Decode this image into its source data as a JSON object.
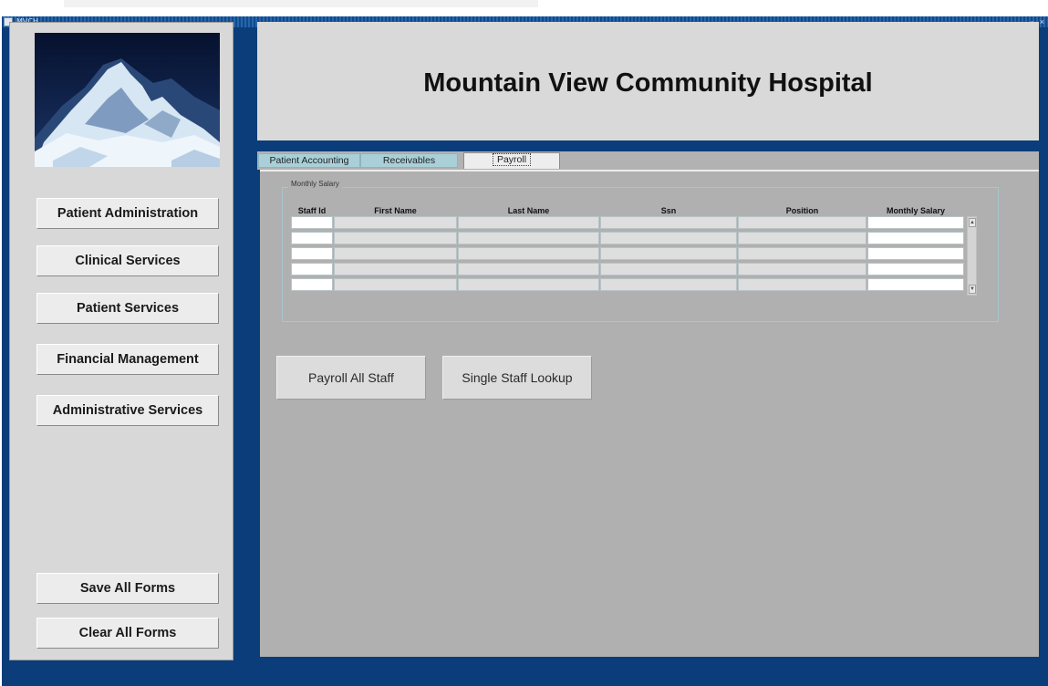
{
  "window": {
    "title": "MVCH",
    "controls": "_ ▫ ×"
  },
  "header": {
    "title": "Mountain View Community Hospital"
  },
  "sidebar": {
    "items": [
      {
        "label": "Patient Administration"
      },
      {
        "label": "Clinical Services"
      },
      {
        "label": "Patient Services"
      },
      {
        "label": "Financial Management"
      },
      {
        "label": "Administrative Services"
      }
    ],
    "save_label": "Save All Forms",
    "clear_label": "Clear All Forms"
  },
  "tabs": [
    {
      "label": "Patient Accounting"
    },
    {
      "label": "Receivables"
    },
    {
      "label": "Payroll"
    }
  ],
  "payroll": {
    "group_label": "Monthly Salary",
    "columns": [
      "Staff Id",
      "First Name",
      "Last Name",
      "Ssn",
      "Position",
      "Monthly Salary"
    ],
    "rows": [
      [
        "",
        "",
        "",
        "",
        "",
        ""
      ],
      [
        "",
        "",
        "",
        "",
        "",
        ""
      ],
      [
        "",
        "",
        "",
        "",
        "",
        ""
      ],
      [
        "",
        "",
        "",
        "",
        "",
        ""
      ],
      [
        "",
        "",
        "",
        "",
        "",
        ""
      ]
    ],
    "payroll_all_label": "Payroll All Staff",
    "single_lookup_label": "Single Staff Lookup"
  },
  "icons": {
    "app": "app-icon",
    "logo": "mountain-logo-image",
    "scroll_up": "arrow-up-icon",
    "scroll_down": "arrow-down-icon"
  },
  "colors": {
    "window_frame": "#0a3d7a",
    "panel": "#d8d8d8",
    "content": "#b0b0b0",
    "tab_inactive": "#a9d0d8"
  }
}
